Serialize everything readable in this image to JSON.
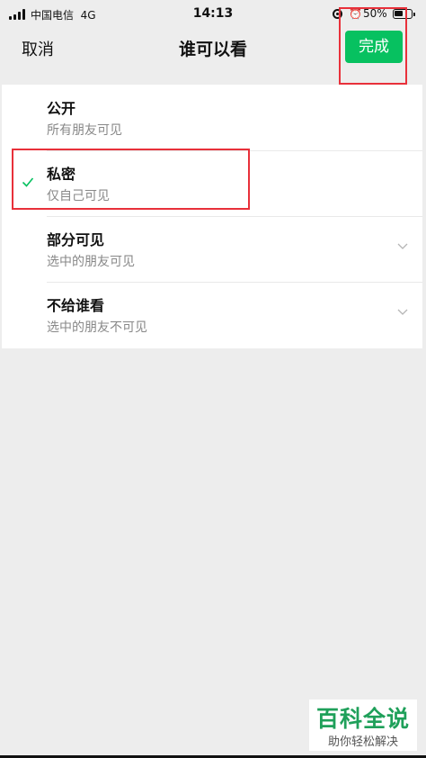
{
  "status_bar": {
    "carrier": "中国电信",
    "network": "4G",
    "time": "14:13",
    "battery": "50%"
  },
  "nav": {
    "cancel_label": "取消",
    "title": "谁可以看",
    "done_label": "完成"
  },
  "options": [
    {
      "title": "公开",
      "subtitle": "所有朋友可见",
      "selected": false,
      "expandable": false
    },
    {
      "title": "私密",
      "subtitle": "仅自己可见",
      "selected": true,
      "expandable": false
    },
    {
      "title": "部分可见",
      "subtitle": "选中的朋友可见",
      "selected": false,
      "expandable": true
    },
    {
      "title": "不给谁看",
      "subtitle": "选中的朋友不可见",
      "selected": false,
      "expandable": true
    }
  ],
  "colors": {
    "accent": "#07c160",
    "highlight": "#e8303a",
    "background": "#ededed"
  },
  "watermark": {
    "title": "百科全说",
    "subtitle": "助你轻松解决"
  }
}
